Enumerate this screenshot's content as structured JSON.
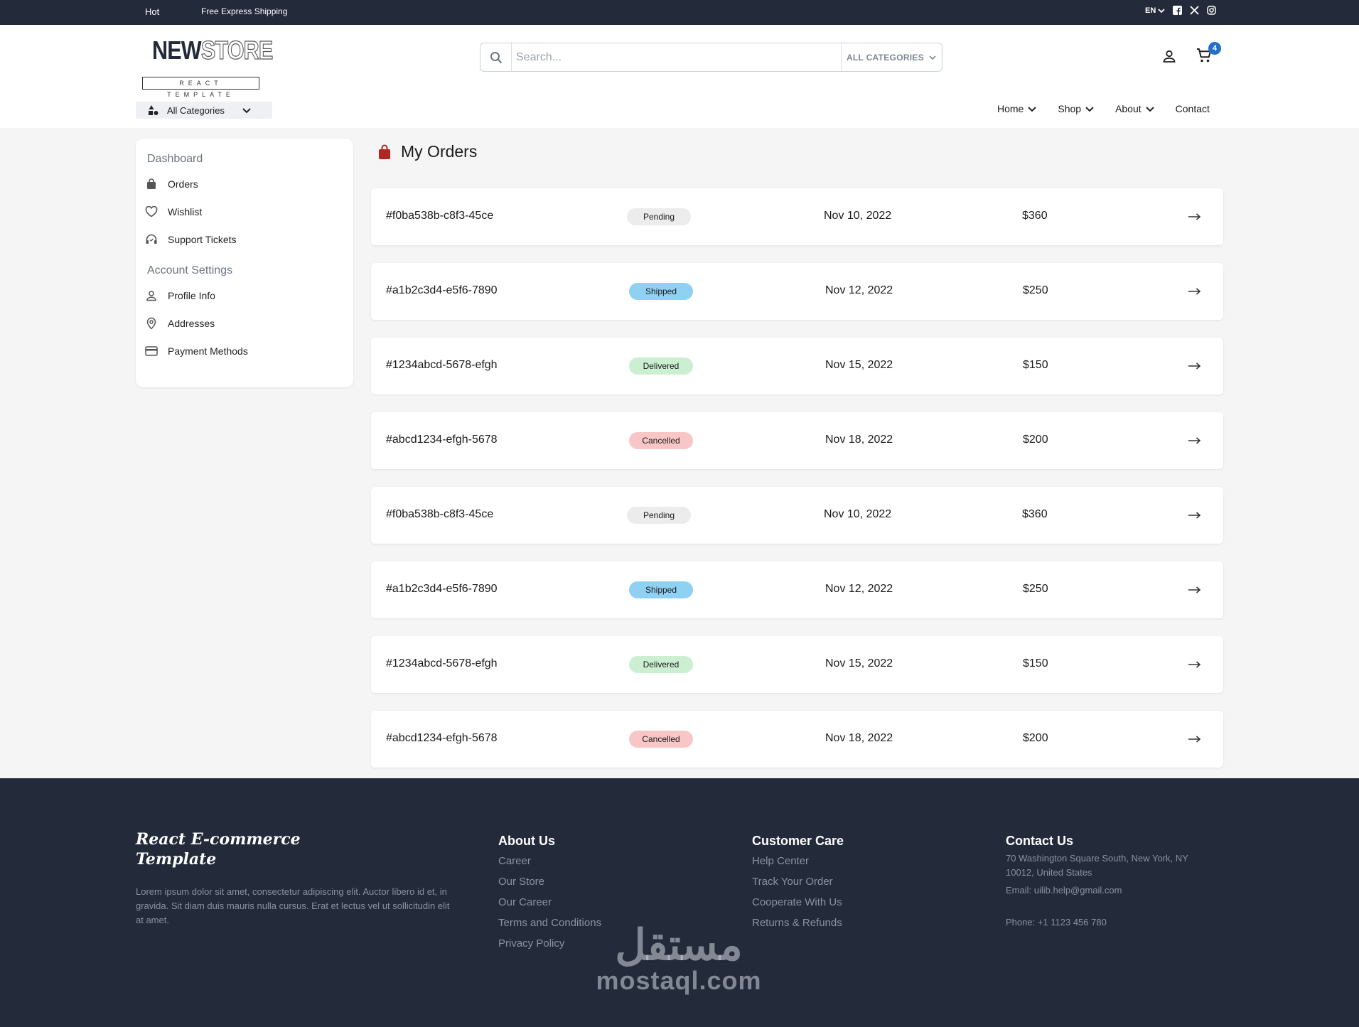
{
  "topbar": {
    "hot": "Hot",
    "shipping": "Free Express Shipping",
    "language": "EN"
  },
  "header": {
    "logo_word1": "NEW",
    "logo_word2": "STORE",
    "logo_sub": "REACT TEMPLATE",
    "search_placeholder": "Search...",
    "search_category": "ALL CATEGORIES",
    "cart_count": "4",
    "all_categories": "All Categories"
  },
  "nav": {
    "home": "Home",
    "shop": "Shop",
    "about": "About",
    "contact": "Contact"
  },
  "sidebar": {
    "dashboard_title": "Dashboard",
    "dashboard_items": [
      {
        "label": "Orders",
        "icon": "shopping-bag-icon"
      },
      {
        "label": "Wishlist",
        "icon": "heart-icon"
      },
      {
        "label": "Support Tickets",
        "icon": "headset-icon"
      }
    ],
    "account_title": "Account Settings",
    "account_items": [
      {
        "label": "Profile Info",
        "icon": "user-icon"
      },
      {
        "label": "Addresses",
        "icon": "location-pin-icon"
      },
      {
        "label": "Payment Methods",
        "icon": "credit-card-icon"
      }
    ]
  },
  "main": {
    "title": "My Orders",
    "orders": [
      {
        "id": "#f0ba538b-c8f3-45ce",
        "status": "Pending",
        "date": "Nov 10, 2022",
        "price": "$360"
      },
      {
        "id": "#a1b2c3d4-e5f6-7890",
        "status": "Shipped",
        "date": "Nov 12, 2022",
        "price": "$250"
      },
      {
        "id": "#1234abcd-5678-efgh",
        "status": "Delivered",
        "date": "Nov 15, 2022",
        "price": "$150"
      },
      {
        "id": "#abcd1234-efgh-5678",
        "status": "Cancelled",
        "date": "Nov 18, 2022",
        "price": "$200"
      },
      {
        "id": "#f0ba538b-c8f3-45ce",
        "status": "Pending",
        "date": "Nov 10, 2022",
        "price": "$360"
      },
      {
        "id": "#a1b2c3d4-e5f6-7890",
        "status": "Shipped",
        "date": "Nov 12, 2022",
        "price": "$250"
      },
      {
        "id": "#1234abcd-5678-efgh",
        "status": "Delivered",
        "date": "Nov 15, 2022",
        "price": "$150"
      },
      {
        "id": "#abcd1234-efgh-5678",
        "status": "Cancelled",
        "date": "Nov 18, 2022",
        "price": "$200"
      }
    ],
    "status_colors": {
      "Pending": "#ececec",
      "Shipped": "#8fd1f2",
      "Delivered": "#ccefd2",
      "Cancelled": "#f8c6c6"
    }
  },
  "footer": {
    "brand_line1": "React E-commerce",
    "brand_line2": "Template",
    "description": "Lorem ipsum dolor sit amet, consectetur adipiscing elit. Auctor libero id et, in gravida. Sit diam duis mauris nulla cursus. Erat et lectus vel ut sollicitudin elit at amet.",
    "about_title": "About Us",
    "about_links": [
      "Career",
      "Our Store",
      "Our Career",
      "Terms and Conditions",
      "Privacy Policy"
    ],
    "care_title": "Customer Care",
    "care_links": [
      "Help Center",
      "Track Your Order",
      "Cooperate With Us",
      "Returns & Refunds"
    ],
    "contact_title": "Contact Us",
    "address": "70 Washington Square South, New York, NY 10012, United States",
    "email": "Email: uilib.help@gmail.com",
    "phone": "Phone: +1 1123 456 780"
  },
  "watermark": {
    "arabic": "مستقل",
    "latin": "mostaql.com"
  },
  "colors": {
    "dark": "#232a3a",
    "accent_blue": "#1f72c8",
    "title_icon": "#b3261e"
  }
}
